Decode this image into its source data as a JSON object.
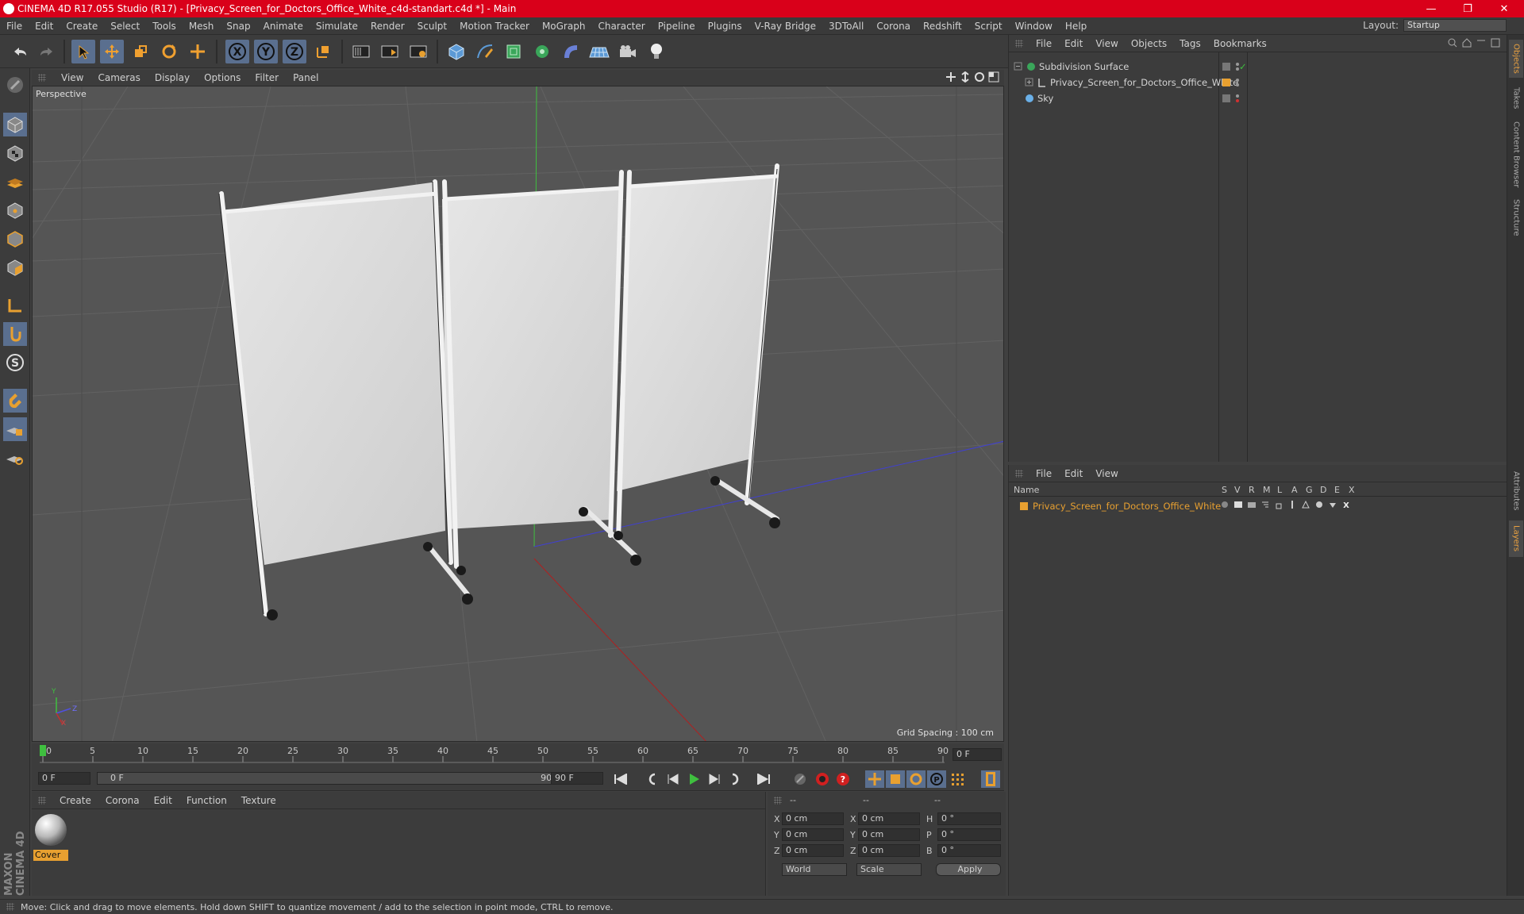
{
  "window": {
    "title": "CINEMA 4D R17.055 Studio (R17) - [Privacy_Screen_for_Doctors_Office_White_c4d-standart.c4d *] - Main",
    "minimize": "—",
    "maximize": "❐",
    "close": "✕"
  },
  "menubar": [
    "File",
    "Edit",
    "Create",
    "Select",
    "Tools",
    "Mesh",
    "Snap",
    "Animate",
    "Simulate",
    "Render",
    "Sculpt",
    "Motion Tracker",
    "MoGraph",
    "Character",
    "Pipeline",
    "Plugins",
    "V-Ray Bridge",
    "3DToAll",
    "Corona",
    "Redshift",
    "Script",
    "Window",
    "Help"
  ],
  "layout": {
    "label": "Layout:",
    "value": "Startup"
  },
  "viewport": {
    "menu": [
      "View",
      "Cameras",
      "Display",
      "Options",
      "Filter",
      "Panel"
    ],
    "label": "Perspective",
    "grid_spacing": "Grid Spacing : 100 cm",
    "axis_y": "Y",
    "axis_z": "Z",
    "axis_x": "X"
  },
  "timeline": {
    "ticks": [
      "0",
      "5",
      "10",
      "15",
      "20",
      "25",
      "30",
      "35",
      "40",
      "45",
      "50",
      "55",
      "60",
      "65",
      "70",
      "75",
      "80",
      "85",
      "90"
    ],
    "frame_field": "0 F"
  },
  "transport": {
    "start": "0 F",
    "range_start": "0 F",
    "range_end": "90 F",
    "end": "90 F"
  },
  "material_panel": {
    "menu": [
      "Create",
      "Corona",
      "Edit",
      "Function",
      "Texture"
    ],
    "material_name": "Cover"
  },
  "coords": {
    "head1": "--",
    "head2": "--",
    "head3": "--",
    "rows": [
      {
        "l1": "X",
        "v1": "0 cm",
        "l2": "X",
        "v2": "0 cm",
        "l3": "H",
        "v3": "0 °"
      },
      {
        "l1": "Y",
        "v1": "0 cm",
        "l2": "Y",
        "v2": "0 cm",
        "l3": "P",
        "v3": "0 °"
      },
      {
        "l1": "Z",
        "v1": "0 cm",
        "l2": "Z",
        "v2": "0 cm",
        "l3": "B",
        "v3": "0 °"
      }
    ],
    "world": "World",
    "scale": "Scale",
    "apply": "Apply"
  },
  "object_manager": {
    "menu": [
      "File",
      "Edit",
      "View",
      "Objects",
      "Tags",
      "Bookmarks"
    ],
    "objects": [
      {
        "name": "Subdivision Surface"
      },
      {
        "name": "Privacy_Screen_for_Doctors_Office_White"
      },
      {
        "name": "Sky"
      }
    ]
  },
  "layer_manager": {
    "menu": [
      "File",
      "Edit",
      "View"
    ],
    "columns": [
      "Name",
      "S",
      "V",
      "R",
      "M",
      "L",
      "A",
      "G",
      "D",
      "E",
      "X"
    ],
    "layer_name": "Privacy_Screen_for_Doctors_Office_White",
    "layer_color": "#e8a030"
  },
  "right_tabs": [
    "Objects",
    "Takes",
    "Content Browser",
    "Structure",
    "Attributes",
    "Layers"
  ],
  "statusbar": "Move: Click and drag to move elements. Hold down SHIFT to quantize movement / add to the selection in point mode, CTRL to remove.",
  "brand": "MAXON CINEMA 4D",
  "colors": {
    "accent": "#e8a030",
    "title_bar": "#d9001a",
    "active_tool": "#5a6f8f"
  }
}
